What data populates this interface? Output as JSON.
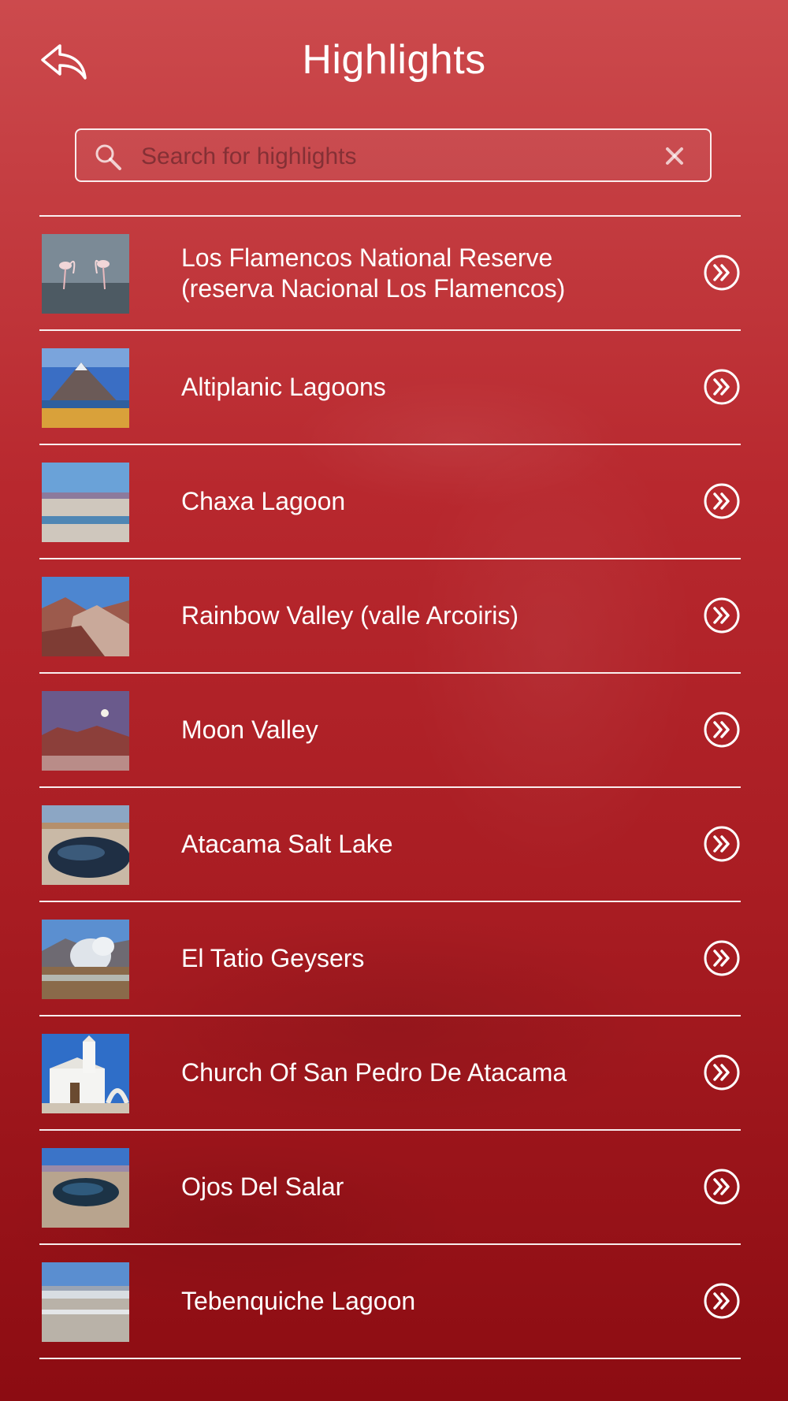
{
  "header": {
    "title": "Highlights",
    "back_icon": "back-arrow-icon"
  },
  "search": {
    "placeholder": "Search for highlights",
    "value": "",
    "search_icon": "search-icon",
    "clear_icon": "close-icon"
  },
  "items": [
    {
      "label": "Los Flamencos National Reserve\n(reserva Nacional Los Flamencos)",
      "thumb": "flamingos"
    },
    {
      "label": "Altiplanic Lagoons",
      "thumb": "volcano"
    },
    {
      "label": "Chaxa Lagoon",
      "thumb": "lagoon"
    },
    {
      "label": "Rainbow Valley (valle Arcoiris)",
      "thumb": "valley"
    },
    {
      "label": "Moon Valley",
      "thumb": "moon"
    },
    {
      "label": "Atacama Salt Lake",
      "thumb": "saltlake"
    },
    {
      "label": "El Tatio Geysers",
      "thumb": "geysers"
    },
    {
      "label": "Church Of San Pedro De Atacama",
      "thumb": "church"
    },
    {
      "label": "Ojos Del Salar",
      "thumb": "ojos"
    },
    {
      "label": "Tebenquiche Lagoon",
      "thumb": "tebenquiche"
    }
  ],
  "colors": {
    "accent": "#ffffff",
    "background_top": "#cc4a4d",
    "background_bottom": "#8c0c12"
  }
}
